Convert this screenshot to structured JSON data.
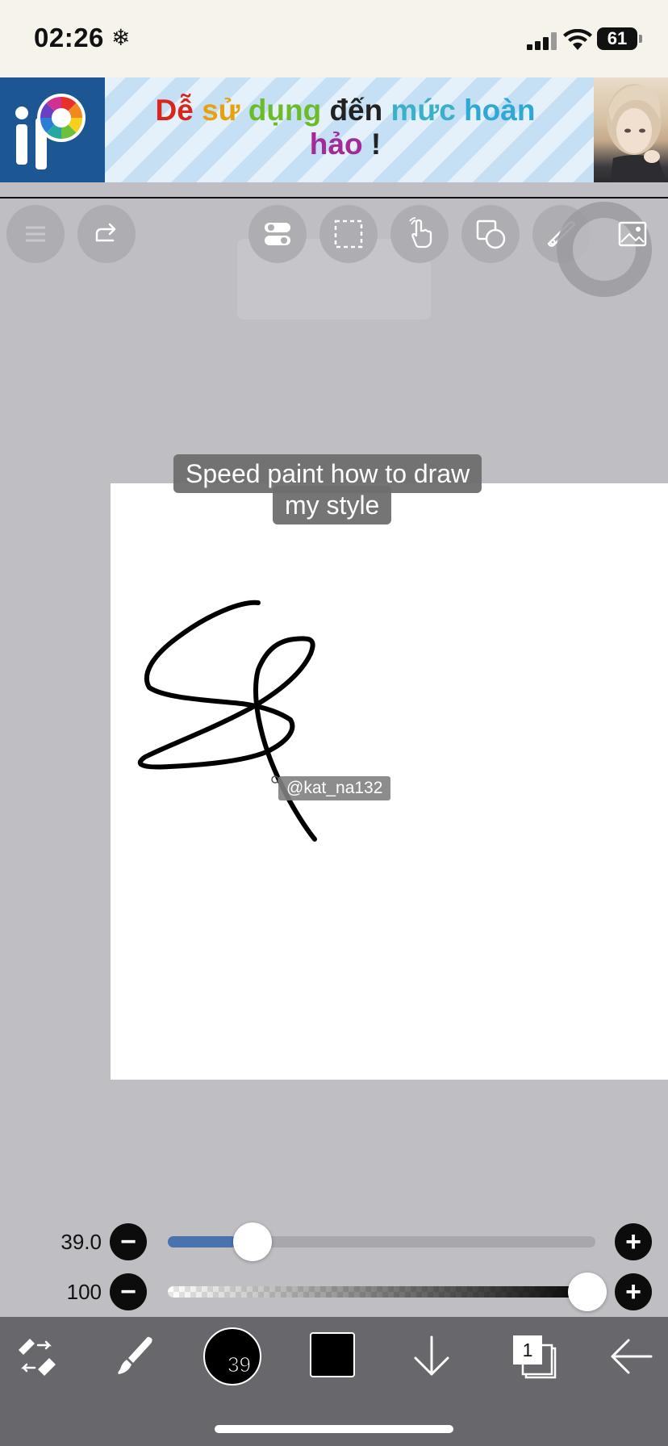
{
  "status_bar": {
    "time": "02:26",
    "snow_icon": "❄",
    "battery": "61"
  },
  "ad": {
    "line1": [
      {
        "text": "Dễ",
        "color": "#d8261c"
      },
      {
        "text": " sử",
        "color": "#e8a10e"
      },
      {
        "text": " dụng",
        "color": "#6bbb2b"
      },
      {
        "text": " đến",
        "color": "#222222"
      },
      {
        "text": " mức",
        "color": "#3bb0c8"
      },
      {
        "text": " hoàn",
        "color": "#2fa8d8"
      }
    ],
    "line2_a": "hảo",
    "line2_b": " !"
  },
  "toolbar": {
    "icons": [
      "menu-icon",
      "redo-icon",
      "toggle-icon",
      "selection-icon",
      "hand-icon",
      "shape-icon",
      "ruler-icon",
      "image-icon"
    ]
  },
  "caption": {
    "line1": "Speed paint how to draw",
    "line2": "my style"
  },
  "watermark": "@kat_na132",
  "sliders": {
    "size": {
      "value": "39.0",
      "fraction": 0.16
    },
    "opacity": {
      "value": "100",
      "fraction": 1.0
    }
  },
  "bottom_bar": {
    "brush_size": "39",
    "layer_count": "1",
    "color": "#000000"
  },
  "colors": {
    "canvas_bg": "#bfbec3",
    "accent_slider": "#4a72ad",
    "bottom_bar": "#68676c"
  }
}
